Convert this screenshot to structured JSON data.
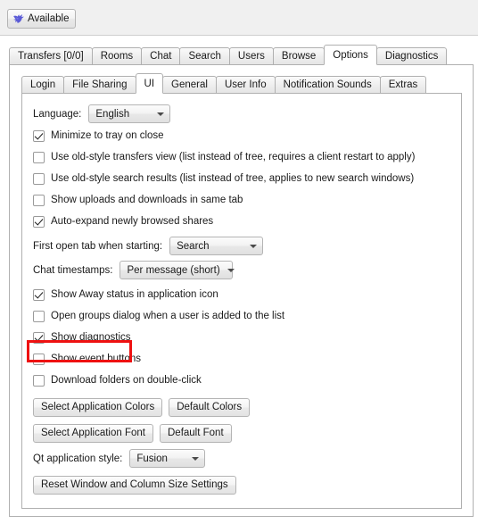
{
  "toolbar": {
    "status_button_label": "Available",
    "status_icon": "bird-icon",
    "status_icon_color": "#5b5bd6"
  },
  "main_tabs": [
    {
      "label": "Transfers [0/0]",
      "selected": false
    },
    {
      "label": "Rooms",
      "selected": false
    },
    {
      "label": "Chat",
      "selected": false
    },
    {
      "label": "Search",
      "selected": false
    },
    {
      "label": "Users",
      "selected": false
    },
    {
      "label": "Browse",
      "selected": false
    },
    {
      "label": "Options",
      "selected": true
    },
    {
      "label": "Diagnostics",
      "selected": false
    }
  ],
  "sub_tabs": [
    {
      "label": "Login",
      "selected": false
    },
    {
      "label": "File Sharing",
      "selected": false
    },
    {
      "label": "UI",
      "selected": true
    },
    {
      "label": "General",
      "selected": false
    },
    {
      "label": "User Info",
      "selected": false
    },
    {
      "label": "Notification Sounds",
      "selected": false
    },
    {
      "label": "Extras",
      "selected": false
    }
  ],
  "ui_options": {
    "language": {
      "label": "Language:",
      "value": "English"
    },
    "checkboxes": [
      {
        "label": "Minimize to tray on close",
        "checked": true
      },
      {
        "label": "Use old-style transfers view (list instead of tree, requires a client restart to apply)",
        "checked": false
      },
      {
        "label": "Use old-style search results (list instead of tree, applies to new search windows)",
        "checked": false
      },
      {
        "label": "Show uploads and downloads in same tab",
        "checked": false
      },
      {
        "label": "Auto-expand newly browsed shares",
        "checked": true
      }
    ],
    "first_open_tab": {
      "label": "First open tab when starting:",
      "value": "Search"
    },
    "chat_timestamps": {
      "label": "Chat timestamps:",
      "value": "Per message (short)"
    },
    "checkboxes2": [
      {
        "label": "Show Away status in application icon",
        "checked": true
      },
      {
        "label": "Open groups dialog when a user is added to the list",
        "checked": false
      },
      {
        "label": "Show diagnostics",
        "checked": true,
        "highlighted": true
      },
      {
        "label": "Show event buttons",
        "checked": false
      },
      {
        "label": "Download folders on double-click",
        "checked": false
      }
    ],
    "buttons": {
      "select_application_colors": "Select Application Colors",
      "default_colors": "Default Colors",
      "select_application_font": "Select Application Font",
      "default_font": "Default Font",
      "reset_window": "Reset Window and Column Size Settings"
    },
    "qt_style": {
      "label": "Qt application style:",
      "value": "Fusion"
    }
  },
  "annotation": {
    "color": "#ee1111",
    "target": "Show diagnostics"
  }
}
